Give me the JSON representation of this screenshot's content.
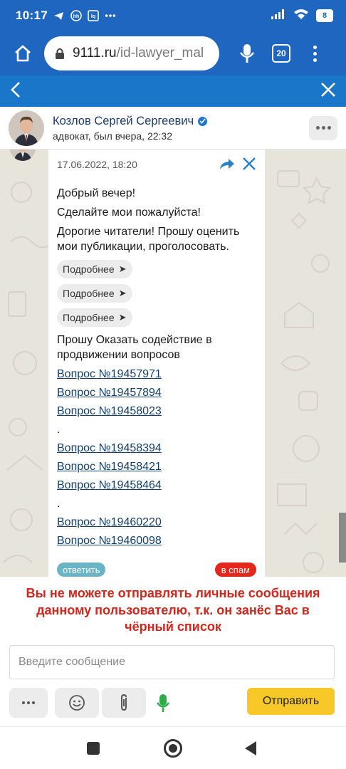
{
  "status_bar": {
    "time": "10:17",
    "battery": "8",
    "notif_icons": [
      "telegram-icon",
      "hh-icon",
      "lq-icon",
      "more-dots-icon"
    ]
  },
  "browser": {
    "url_host": "9111.ru",
    "url_path": "/id-lawyer_mal",
    "tab_count": "20"
  },
  "chat_header": {
    "name": "Козлов Сергей Сергеевич",
    "status": "адвокат, был вчера, 22:32"
  },
  "message": {
    "date": "17.06.2022, 18:20",
    "lines": {
      "l1": "Добрый вечер!",
      "l2": "Сделайте мои пожалуйста!",
      "l3": "Дорогие читатели! Прошу оценить мои публикации, проголосовать.",
      "l4": "Прошу Оказать содействие в продвижении вопросов"
    },
    "more_label": "Подробнее",
    "dot": ".",
    "questions": {
      "q1": "Вопрос №19457971",
      "q2": "Вопрос №19457894",
      "q3": "Вопрос №19458023",
      "q4": "Вопрос №19458394",
      "q5": "Вопрос №19458421",
      "q6": "Вопрос №19458464",
      "q7": "Вопрос №19460220",
      "q8": "Вопрос №19460098"
    },
    "reply_label": "ответить",
    "spam_label": "в спам"
  },
  "footer": {
    "blocked_notice": "Вы не можете отправлять личные сообщения данному пользователю, т.к. он занёс Вас в чёрный список",
    "input_placeholder": "Введите сообщение",
    "send_label": "Отправить"
  },
  "colors": {
    "brand_blue": "#1e66c0",
    "nav_blue": "#1a76c9",
    "link": "#14406a",
    "blocked_red": "#d3261c",
    "send_yellow": "#f7c827",
    "reply_teal": "#6ab4c5",
    "spam_red": "#e5271b"
  }
}
